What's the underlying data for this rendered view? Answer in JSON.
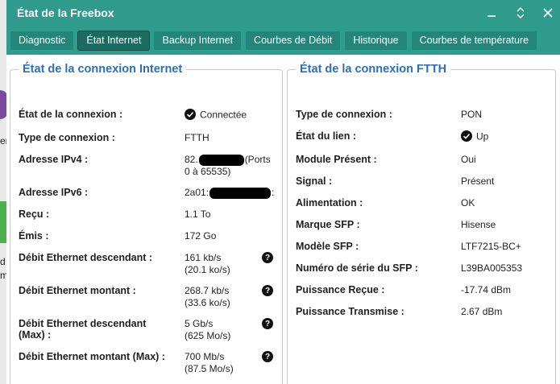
{
  "window": {
    "title": "État de la Freebox"
  },
  "tabs": [
    {
      "label": "Diagnostic",
      "active": false
    },
    {
      "label": "État Internet",
      "active": true
    },
    {
      "label": "Backup Internet",
      "active": false
    },
    {
      "label": "Courbes de Débit",
      "active": false
    },
    {
      "label": "Historique",
      "active": false
    },
    {
      "label": "Courbes de température",
      "active": false
    }
  ],
  "background_app": {
    "fragments": [
      "er",
      "d",
      "m"
    ]
  },
  "internet": {
    "legend": "État de la connexion Internet",
    "rows": [
      {
        "label": "État de la connexion :",
        "value": "Connectée",
        "icon": "check-circle-icon"
      },
      {
        "label": "Type de connexion :",
        "value": "FTTH"
      },
      {
        "label": "Adresse IPv4 :",
        "value_prefix": "82.",
        "value_suffix": "(Ports",
        "value_line2": "0 à 65535)"
      },
      {
        "label": "Adresse IPv6 :",
        "value_prefix": "2a01:",
        "value_suffix": ":"
      },
      {
        "label": "Reçu :",
        "value": "1.1 To"
      },
      {
        "label": "Émis :",
        "value": "172 Go"
      },
      {
        "label": "Débit Ethernet descendant :",
        "value": "161 kb/s",
        "value_line2": "(20.1 ko/s)",
        "help": "?"
      },
      {
        "label": "Débit Ethernet montant :",
        "value": "268.7 kb/s",
        "value_line2": "(33.6 ko/s)",
        "help": "?"
      },
      {
        "label": "Débit Ethernet descendant",
        "label_line2": "(Max) :",
        "value": "5 Gb/s",
        "value_line2": "(625 Mo/s)",
        "help": "?"
      },
      {
        "label": "Débit Ethernet montant (Max) :",
        "value": "700 Mb/s",
        "value_line2": "(87.5 Mo/s)",
        "help": "?"
      }
    ]
  },
  "ftth": {
    "legend": "État de la connexion FTTH",
    "rows": [
      {
        "label": "Type de connexion :",
        "value": "PON"
      },
      {
        "label": "État du lien :",
        "value": "Up",
        "icon": "check-circle-icon"
      },
      {
        "label": "Module Présent :",
        "value": "Oui"
      },
      {
        "label": "Signal :",
        "value": "Présent"
      },
      {
        "label": "Alimentation :",
        "value": "OK"
      },
      {
        "label": "Marque SFP :",
        "value": "Hisense"
      },
      {
        "label": "Modèle SFP :",
        "value": "LTF7215-BC+"
      },
      {
        "label": "Numéro de série du SFP :",
        "value": "L39BA005353"
      },
      {
        "label": "Puissance Reçue :",
        "value": "-17.74 dBm"
      },
      {
        "label": "Puissance Transmise :",
        "value": "2.67 dBm"
      }
    ]
  },
  "colors": {
    "titlebar": "#2e9b8d",
    "tab": "#24857a",
    "tab_active": "#1b6b62",
    "legend": "#2a6fb8"
  }
}
